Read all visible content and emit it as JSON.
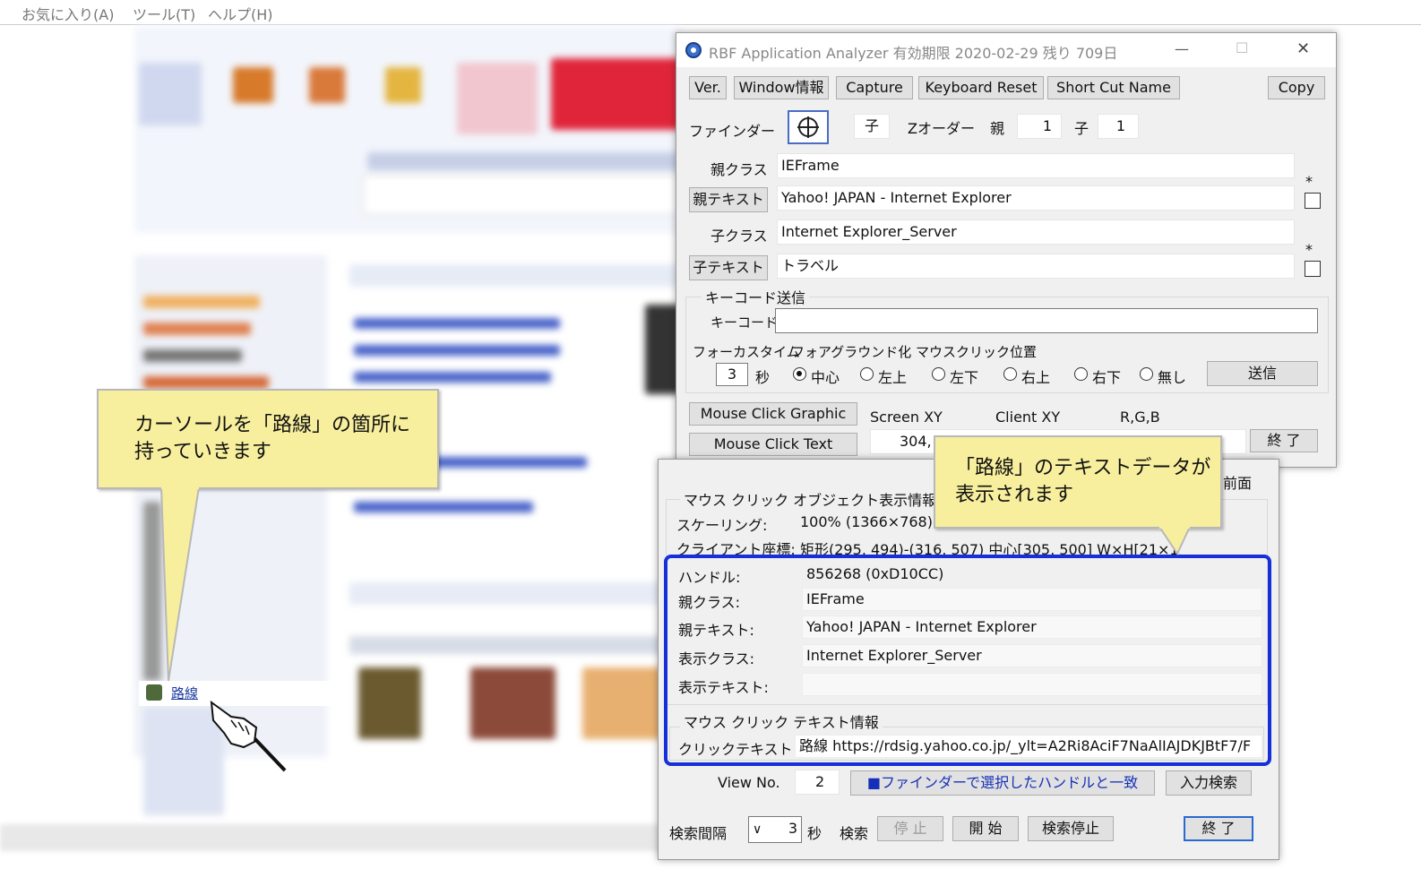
{
  "browser_menu": {
    "favorites": "お気に入り(A)",
    "tools": "ツール(T)",
    "help": "ヘルプ(H)"
  },
  "page_sidebar": {
    "route_link": "路線"
  },
  "analyzer": {
    "title": "RBF Application Analyzer 有効期限 2020-02-29 残り 709日",
    "minimize": "—",
    "maximize": "☐",
    "close": "✕",
    "toolbar": {
      "ver": "Ver.",
      "window_info": "Window情報",
      "capture": "Capture",
      "keyboard_reset": "Keyboard Reset",
      "short_cut_name": "Short Cut Name",
      "copy": "Copy"
    },
    "finder_label": "ファインダー",
    "child_label": "子",
    "zorder_label": "Zオーダー",
    "zorder_parent_label": "親",
    "zorder_parent_value": "1",
    "zorder_child_label": "子",
    "zorder_child_value": "1",
    "parent_class_label": "親クラス",
    "parent_class_value": "IEFrame",
    "parent_text_button": "親テキスト",
    "parent_text_value": "Yahoo! JAPAN - Internet Explorer",
    "child_class_label": "子クラス",
    "child_class_value": "Internet Explorer_Server",
    "child_text_button": "子テキスト",
    "child_text_value": "トラベル",
    "asterisk": "*",
    "keycode_group": "キーコード送信",
    "keycode_label": "キーコード:",
    "keycode_value": "",
    "focus_time_label": "フォーカスタイム",
    "foreground_label": "フォアグラウンド化 マウスクリック位置",
    "focus_time_value": "3",
    "seconds": "秒",
    "radios": {
      "center": "中心",
      "top_left": "左上",
      "bottom_left": "左下",
      "top_right": "右上",
      "bottom_right": "右下",
      "none": "無し"
    },
    "send_button": "送信",
    "mouse_click_graphic": "Mouse Click Graphic",
    "mouse_click_text": "Mouse Click Text",
    "screen_xy_label": "Screen XY",
    "client_xy_label": "Client XY",
    "rgb_label": "R,G,B",
    "screen_xy_value": "304, 5",
    "end_button": "終 了"
  },
  "popup": {
    "front_label": "前面",
    "object_info_group": "マウス クリック オブジェクト表示情報",
    "scaling_label": "スケーリング:",
    "scaling_value": "100% (1366×768)",
    "client_coord_label": "クライアント座標:",
    "client_coord_value": "矩形(295, 494)-(316, 507) 中心[305, 500] W×H[21×13",
    "handle_label": "ハンドル:",
    "handle_value": "856268 (0xD10CC)",
    "parent_class_label": "親クラス:",
    "parent_class_value": "IEFrame",
    "parent_text_label": "親テキスト:",
    "parent_text_value": "Yahoo! JAPAN - Internet Explorer",
    "display_class_label": "表示クラス:",
    "display_class_value": "Internet Explorer_Server",
    "display_text_label": "表示テキスト:",
    "display_text_value": "",
    "text_info_group": "マウス クリック テキスト情報",
    "click_text_label": "クリックテキスト",
    "click_text_value": "路線 https://rdsig.yahoo.co.jp/_ylt=A2Ri8AciF7NaAlIAJDKJBtF7/F",
    "view_no_label": "View No.",
    "view_no_value": "2",
    "match_button": "■ファインダーで選択したハンドルと一致",
    "input_search_button": "入力検索",
    "search_interval_label": "検索間隔",
    "search_interval_value": "3",
    "seconds": "秒",
    "search_label": "検索",
    "stop_button": "停 止",
    "start_button": "開 始",
    "search_stop_button": "検索停止",
    "end_button": "終 了"
  },
  "callouts": {
    "left": "カーソールを「路線」の箇所に\n持っていきます",
    "right": "「路線」のテキストデータが\n表示されます"
  },
  "colors": {
    "callout_fill": "#f7ef9d",
    "highlight_border": "#1530d8",
    "window_bg": "#f0f0f0"
  }
}
